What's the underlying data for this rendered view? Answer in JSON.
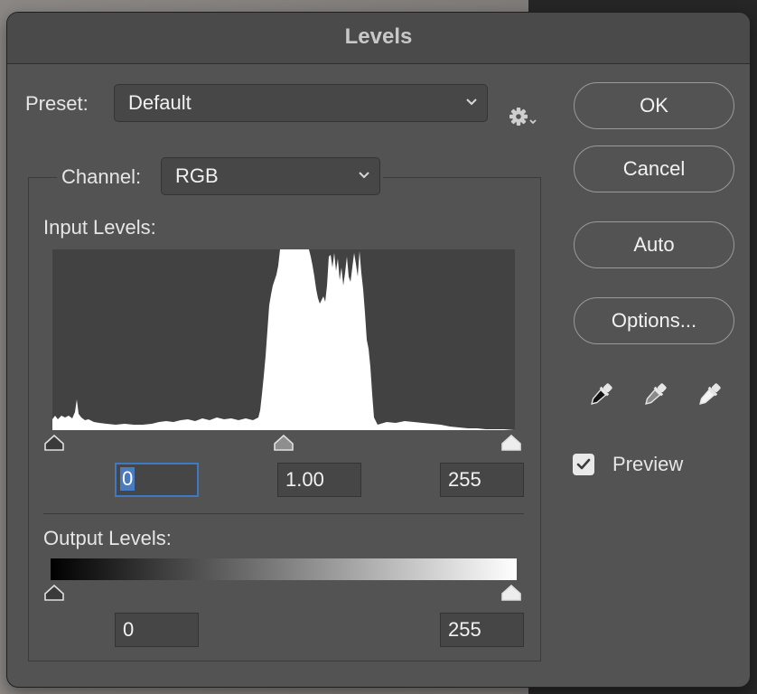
{
  "dialog": {
    "title": "Levels"
  },
  "preset": {
    "label": "Preset:",
    "value": "Default"
  },
  "channel": {
    "label": "Channel:",
    "value": "RGB"
  },
  "input_levels": {
    "label": "Input Levels:",
    "black": "0",
    "gamma": "1.00",
    "white": "255"
  },
  "output_levels": {
    "label": "Output Levels:",
    "black": "0",
    "white": "255"
  },
  "buttons": {
    "ok": "OK",
    "cancel": "Cancel",
    "auto": "Auto",
    "options": "Options..."
  },
  "preview": {
    "label": "Preview",
    "checked": true
  },
  "icons": {
    "settings": "gear-icon",
    "black_eyedropper": "eyedropper-black-icon",
    "gray_eyedropper": "eyedropper-gray-icon",
    "white_eyedropper": "eyedropper-white-icon"
  },
  "colors": {
    "dialog_bg": "#535353",
    "focus": "#3d79c5",
    "histogram_bg": "#424242",
    "histogram_fill": "#ffffff"
  }
}
